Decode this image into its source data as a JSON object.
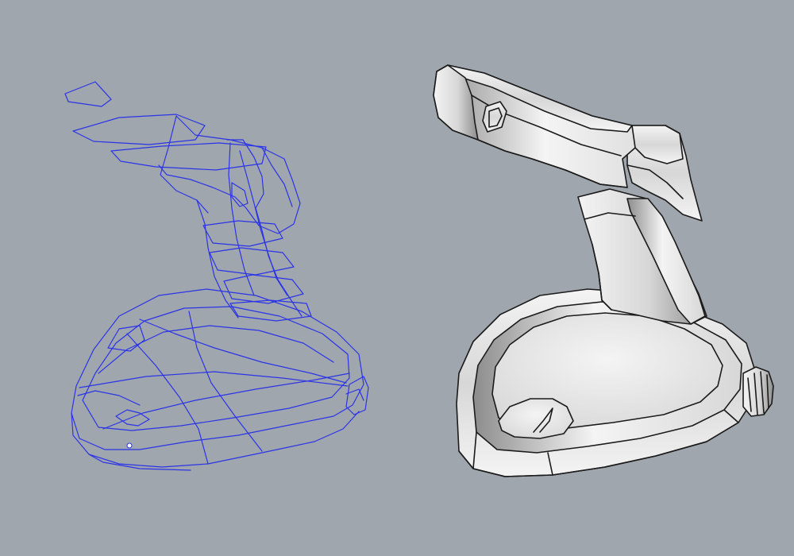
{
  "viewport": {
    "background": "#a0a6ad"
  },
  "models": {
    "wireframe": {
      "display_mode": "wireframe",
      "curve_color": "#2b34e6",
      "point_color": "#ffffff"
    },
    "shaded": {
      "display_mode": "shaded",
      "edge_color": "#1b1b1b",
      "surface_light": "#f4f4f4",
      "surface_mid": "#d7d7d7",
      "surface_dark": "#8c8c8c"
    }
  }
}
